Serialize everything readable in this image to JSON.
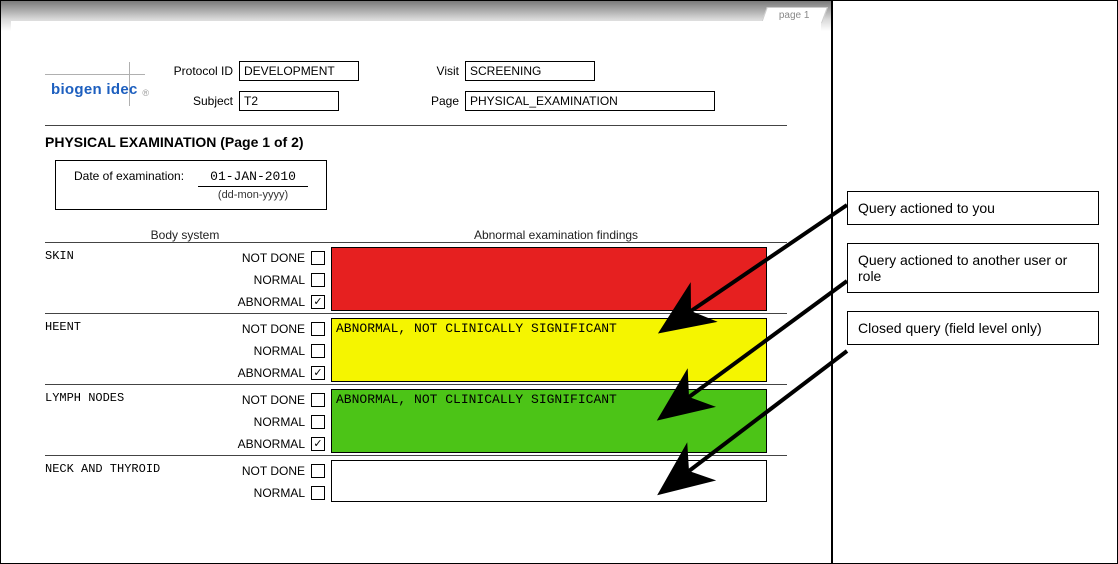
{
  "page_tab": "page 1",
  "logo": {
    "text": "biogen idec"
  },
  "header": {
    "protocol_label": "Protocol ID",
    "protocol_value": "DEVELOPMENT",
    "subject_label": "Subject",
    "subject_value": "T2",
    "visit_label": "Visit",
    "visit_value": "SCREENING",
    "page_label": "Page",
    "page_value": "PHYSICAL_EXAMINATION"
  },
  "title": "PHYSICAL EXAMINATION (Page 1 of 2)",
  "exam_date": {
    "label": "Date of examination:",
    "value": "01-JAN-2010",
    "format": "(dd-mon-yyyy)"
  },
  "columns": {
    "left": "Body system",
    "right": "Abnormal examination findings"
  },
  "options": {
    "not_done": "NOT DONE",
    "normal": "NORMAL",
    "abnormal": "ABNORMAL"
  },
  "systems": [
    {
      "name": "SKIN",
      "not_done": false,
      "normal": false,
      "abnormal": true,
      "findings": "",
      "color": "red"
    },
    {
      "name": "HEENT",
      "not_done": false,
      "normal": false,
      "abnormal": true,
      "findings": "ABNORMAL, NOT CLINICALLY SIGNIFICANT",
      "color": "yellow"
    },
    {
      "name": "LYMPH NODES",
      "not_done": false,
      "normal": false,
      "abnormal": true,
      "findings": "ABNORMAL, NOT CLINICALLY SIGNIFICANT",
      "color": "green"
    },
    {
      "name": "NECK AND THYROID",
      "not_done": false,
      "normal": false,
      "abnormal": null,
      "findings": "",
      "color": ""
    }
  ],
  "legend": [
    "Query actioned to you",
    "Query actioned to another user or role",
    "Closed query (field level only)"
  ]
}
